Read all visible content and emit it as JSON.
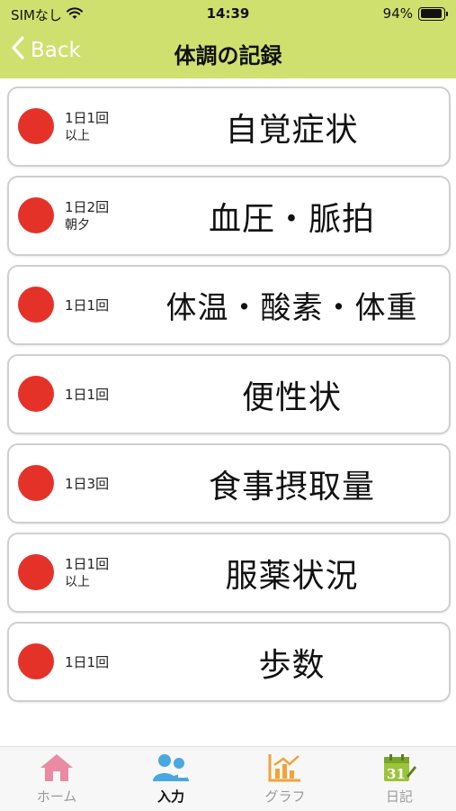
{
  "status_bar": {
    "carrier": "SIMなし",
    "time": "14:39",
    "battery": "94%",
    "battery_level": 0.94
  },
  "nav": {
    "back_label": "Back",
    "title": "体調の記録"
  },
  "items": [
    {
      "freq": "1日1回",
      "note": "以上",
      "label": "自覚症状"
    },
    {
      "freq": "1日2回",
      "note": "朝夕",
      "label": "血圧・脈拍"
    },
    {
      "freq": "1日1回",
      "note": "",
      "label": "体温・酸素・体重"
    },
    {
      "freq": "1日1回",
      "note": "",
      "label": "便性状"
    },
    {
      "freq": "1日3回",
      "note": "",
      "label": "食事摂取量"
    },
    {
      "freq": "1日1回",
      "note": "以上",
      "label": "服薬状況"
    },
    {
      "freq": "1日1回",
      "note": "",
      "label": "歩数"
    }
  ],
  "tabs": [
    {
      "label": "ホーム",
      "icon": "home-icon",
      "active": false
    },
    {
      "label": "入力",
      "icon": "users-icon",
      "active": true
    },
    {
      "label": "グラフ",
      "icon": "chart-icon",
      "active": false
    },
    {
      "label": "日記",
      "icon": "calendar-icon",
      "active": false
    }
  ],
  "colors": {
    "header": "#cfe06f",
    "status_dot": "#e53229",
    "home_icon": "#ea8aa3",
    "users_icon": "#4aa7e0",
    "chart_icon": "#f0a23b",
    "calendar_icon": "#9bc43b"
  }
}
